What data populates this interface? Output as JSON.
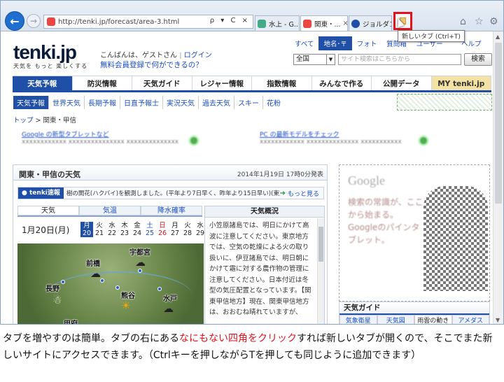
{
  "browser": {
    "address": "http://tenki.jp/forecast/area-3.html",
    "address_controls": "ρ ▾ C ×",
    "tabs": [
      {
        "label": "水上 - G...",
        "close": "×"
      },
      {
        "label": "関東・...",
        "close": "×"
      },
      {
        "label": "ジョルダン...",
        "close": "×"
      }
    ],
    "new_tab_tooltip": "新しいタブ (Ctrl+T)",
    "toolbar_icons": [
      "home-icon",
      "star-icon",
      "gear-icon"
    ],
    "icon_glyphs": {
      "home": "⌂",
      "star": "☆",
      "gear": "⚙"
    }
  },
  "site": {
    "logo": "tenki.jp",
    "tagline": "天気を もっと 楽しくする",
    "greeting": "こんばんは、ゲストさん",
    "login": "ログイン",
    "register": "無料会員登録で何ができるの？",
    "top_tabs": [
      "すべて",
      "地名･〒",
      "フォト",
      "質問箱",
      "ユーザー"
    ],
    "help": "ヘルプ",
    "region_select": "全国",
    "search_placeholder": "サイト検索はこちらから",
    "search_button": "検索",
    "main_nav": [
      "天気予報",
      "防災情報",
      "天気ガイド",
      "レジャー情報",
      "指数情報",
      "みんなで作る",
      "公開データ",
      "MY tenki.jp"
    ],
    "sub_nav": [
      "天気予報",
      "世界天気",
      "長期予報",
      "日直予報士",
      "実況天気",
      "過去天気",
      "スキー",
      "花粉"
    ],
    "breadcrumb": [
      "トップ",
      "関東・甲信"
    ],
    "breadcrumb_sep": ">",
    "ads": [
      {
        "title": "Google の新型タブレットなど",
        "desc": "xxxxxxxxxxxx xxxxxxxxxxxxxxx xxxxxxxxxxxxxx"
      },
      {
        "title": "PC の最新モデルをチェック",
        "desc": "xxxxxxxxxxxx xxxxxxxxxxxxxx xxxxxxxxxxx"
      }
    ]
  },
  "forecast": {
    "title": "関東・甲信の天気",
    "issued": "2014年1月19日 17時0分発表",
    "flash_badge": "tenki速報",
    "flash_text": "樹の開花(ハクバイ)を観測しました。(平年より7日早く、昨年より15日早い)(東京)",
    "flash_more": "もっと見る",
    "tabs": [
      "天気",
      "気温",
      "降水確率"
    ],
    "selected_day": "1月20日(月)",
    "days": [
      {
        "w": "月",
        "d": "20",
        "color": "#fff"
      },
      {
        "w": "火",
        "d": "21",
        "color": "#222"
      },
      {
        "w": "水",
        "d": "22",
        "color": "#222"
      },
      {
        "w": "木",
        "d": "23",
        "color": "#222"
      },
      {
        "w": "金",
        "d": "24",
        "color": "#222"
      },
      {
        "w": "土",
        "d": "25",
        "color": "#1a4cc4"
      },
      {
        "w": "日",
        "d": "26",
        "color": "#e0131f"
      },
      {
        "w": "月",
        "d": "27",
        "color": "#222"
      },
      {
        "w": "火",
        "d": "28",
        "color": "#222"
      },
      {
        "w": "水",
        "d": "29",
        "color": "#222"
      }
    ],
    "map_cities": [
      "宇都宮",
      "前橋",
      "長野",
      "熊谷",
      "水戸",
      "甲府"
    ],
    "overview_title": "天気概況",
    "overview_text": "小笠原諸島では、明日にかけて高波に注意してください。東京地方では、空気の乾燥による火の取り扱いに、伊豆諸島では、明日朝にかけて霜に対する農作物の管理に注意してください。日本付近は冬型の気圧配置となっています。【関東甲信地方】現在、関東甲信地方は、おおむね晴れていますが、"
  },
  "sidebar": {
    "ad_brand": "Google",
    "ad_text": "検索の常識が、ここから始まる。Googleのパインタブレット。",
    "weather_guide_title": "天気ガイド",
    "weather_guide_tabs": [
      "気象衛星",
      "天気図",
      "雨雲の動き",
      "アメダス"
    ]
  },
  "caption": {
    "part1": "タブを増やすのは簡単。タブの右にある",
    "highlight": "なにもない四角をクリック",
    "part2": "すれば新しいタブが開くので、そこでまた新しいサイトにアクセスできます。（Ctrlキーを押しながらTを押しても同じように追加できます）"
  },
  "colors": {
    "accent": "#1f4fa6",
    "highlight": "#e0131f",
    "link": "#1a4cc4"
  }
}
